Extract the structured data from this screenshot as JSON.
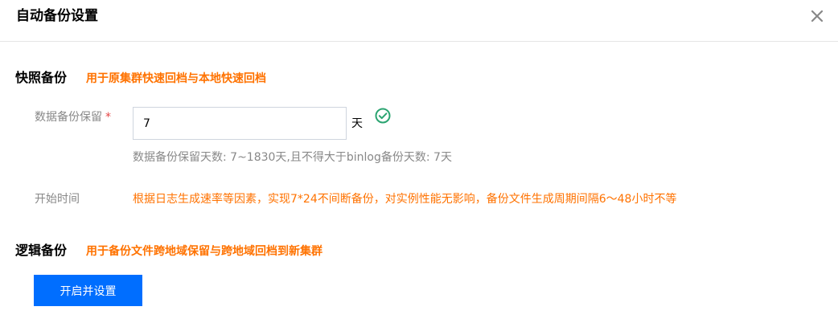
{
  "dialog": {
    "title": "自动备份设置",
    "close_icon": "close-icon"
  },
  "snapshot": {
    "title": "快照备份",
    "description": "用于原集群快速回档与本地快速回档",
    "retention_label": "数据备份保留",
    "required_mark": "*",
    "retention_value": "7",
    "unit": "天",
    "valid_icon": "check-circle-icon",
    "valid_color": "#2ba471",
    "hint": "数据备份保留天数: 7~1830天,且不得大于binlog备份天数: 7天",
    "start_time_label": "开始时间",
    "start_time_text": "根据日志生成速率等因素，实现7*24不间断备份，对实例性能无影响，备份文件生成周期间隔6～48小时不等"
  },
  "logical": {
    "title": "逻辑备份",
    "description": "用于备份文件跨地域保留与跨地域回档到新集群",
    "button_label": "开启并设置"
  },
  "colors": {
    "accent": "#006eff",
    "warning": "#ff7200",
    "required": "#e54545"
  }
}
